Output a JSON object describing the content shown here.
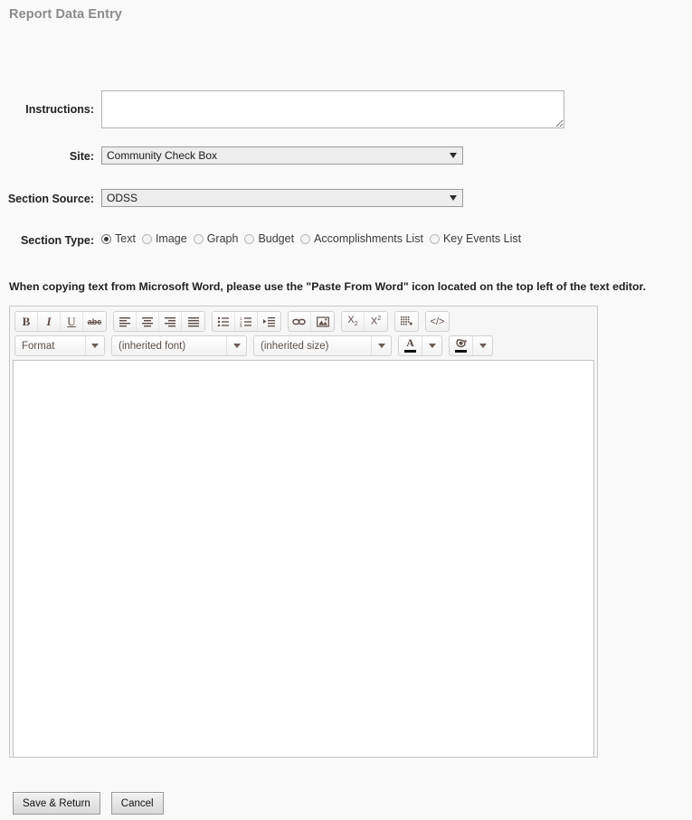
{
  "page": {
    "title": "Report Data Entry",
    "notice": "When copying text from Microsoft Word, please use the \"Paste From Word\" icon located on the top left of the text editor."
  },
  "form": {
    "instructions": {
      "label": "Instructions:",
      "value": "",
      "placeholder": ""
    },
    "site": {
      "label": "Site:",
      "value": "Community Check Box"
    },
    "section_source": {
      "label": "Section Source:",
      "value": "ODSS"
    },
    "section_type": {
      "label": "Section Type:",
      "options": [
        {
          "label": "Text",
          "checked": true
        },
        {
          "label": "Image",
          "checked": false
        },
        {
          "label": "Graph",
          "checked": false
        },
        {
          "label": "Budget",
          "checked": false
        },
        {
          "label": "Accomplishments List",
          "checked": false
        },
        {
          "label": "Key Events List",
          "checked": false
        }
      ]
    }
  },
  "editor": {
    "toolbar_row1": [
      {
        "name": "bold-icon",
        "glyph": "B"
      },
      {
        "name": "italic-icon",
        "glyph": "I"
      },
      {
        "name": "underline-icon",
        "glyph": "U"
      },
      {
        "name": "strikethrough-icon",
        "glyph": "abc"
      },
      {
        "name": "align-left-icon",
        "glyph": ""
      },
      {
        "name": "align-center-icon",
        "glyph": ""
      },
      {
        "name": "align-right-icon",
        "glyph": ""
      },
      {
        "name": "align-justify-icon",
        "glyph": ""
      },
      {
        "name": "bullet-list-icon",
        "glyph": ""
      },
      {
        "name": "numbered-list-icon",
        "glyph": ""
      },
      {
        "name": "indent-icon",
        "glyph": ""
      },
      {
        "name": "link-icon",
        "glyph": ""
      },
      {
        "name": "image-icon",
        "glyph": ""
      },
      {
        "name": "subscript-icon",
        "glyph": "X2"
      },
      {
        "name": "superscript-icon",
        "glyph": "X2"
      },
      {
        "name": "table-icon",
        "glyph": ""
      },
      {
        "name": "source-code-icon",
        "glyph": "</>"
      }
    ],
    "format_select": {
      "value": "Format"
    },
    "font_select": {
      "value": "(inherited font)"
    },
    "size_select": {
      "value": "(inherited size)"
    },
    "text_color": {
      "name": "text-color-icon",
      "glyph": "A",
      "bar_color": "#111111"
    },
    "background_color": {
      "name": "background-color-icon",
      "bar_color": "#111111"
    },
    "content": ""
  },
  "actions": {
    "save": "Save & Return",
    "cancel": "Cancel"
  },
  "colors": {
    "page_background": "#f9f9f9",
    "title": "#8b8b8b",
    "label": "#222222",
    "select_background": "#ededed",
    "editor_chrome": "#f6f6f6",
    "toolbar_icon": "#5d4c46"
  }
}
